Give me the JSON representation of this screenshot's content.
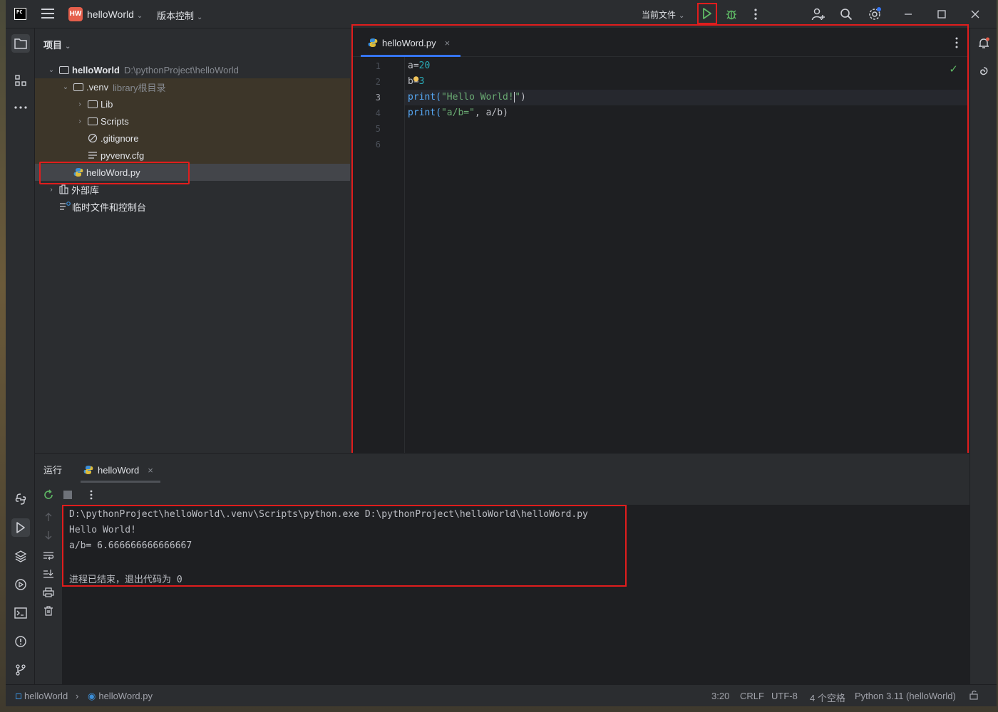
{
  "titlebar": {
    "logo": "PC",
    "project_badge": "HW",
    "project_name": "helloWorld",
    "vcs": "版本控制",
    "run_config": "当前文件"
  },
  "project_panel": {
    "header": "项目",
    "tree": [
      {
        "label": "helloWorld",
        "detail": "D:\\pythonProject\\helloWorld",
        "type": "folder",
        "expanded": true
      },
      {
        "label": ".venv",
        "detail": "library根目录",
        "type": "folder",
        "expanded": true
      },
      {
        "label": "Lib",
        "type": "folder",
        "expanded": false
      },
      {
        "label": "Scripts",
        "type": "folder",
        "expanded": false
      },
      {
        "label": ".gitignore",
        "type": "file-ignore"
      },
      {
        "label": "pyvenv.cfg",
        "type": "file-text"
      },
      {
        "label": "helloWord.py",
        "type": "file-python"
      },
      {
        "label": "外部库",
        "type": "library",
        "expanded": false
      },
      {
        "label": "临时文件和控制台",
        "type": "scratches"
      }
    ]
  },
  "editor": {
    "tab_label": "helloWord.py",
    "line_numbers": [
      "1",
      "2",
      "3",
      "4",
      "5",
      "6"
    ],
    "lines": {
      "l1_a": "a=",
      "l1_b": "20",
      "l2_a": "b=",
      "l2_b": "3",
      "l3_a": "print(",
      "l3_b": "\"Hello World!",
      "l3_c": "\"",
      "l3_d": ")",
      "l4_a": "print(",
      "l4_b": "\"a/b=\"",
      "l4_c": ", a/b)"
    },
    "current_line": 3
  },
  "run_panel": {
    "title": "运行",
    "tab_label": "helloWord",
    "output": [
      "D:\\pythonProject\\helloWorld\\.venv\\Scripts\\python.exe D:\\pythonProject\\helloWorld\\helloWord.py",
      "Hello World!",
      "a/b= 6.666666666666667",
      "",
      "进程已结束，退出代码为 0"
    ]
  },
  "statusbar": {
    "breadcrumb_project": "helloWorld",
    "breadcrumb_file": "helloWord.py",
    "position": "3:20",
    "line_sep": "CRLF",
    "encoding": "UTF-8",
    "indent": "4 个空格",
    "interpreter": "Python 3.11 (helloWorld)"
  },
  "colors": {
    "accent": "#3574f0",
    "highlight_box": "#e01d1d",
    "run_green": "#5fb865"
  }
}
